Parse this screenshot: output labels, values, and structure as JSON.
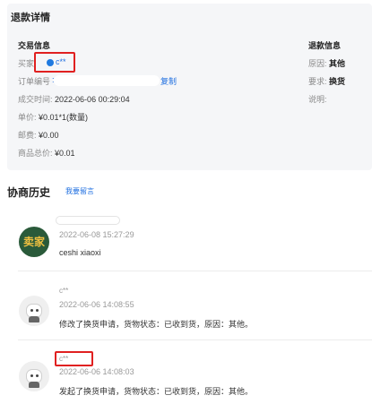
{
  "refund": {
    "title": "退款详情",
    "trade_section": "交易信息",
    "refund_section": "退款信息",
    "buyer_label": "买家",
    "buyer_name": "c**",
    "order_label": "订单编号",
    "order_colon": ":",
    "copy_label": "复制",
    "deal_time_label": "成交时间:",
    "deal_time": "2022-06-06 00:29:04",
    "unit_price_label": "单价:",
    "unit_price": "¥0.01*1(数量)",
    "postage_label": "邮费:",
    "postage": "¥0.00",
    "total_label": "商品总价:",
    "total": "¥0.01",
    "reason_label": "原因:",
    "reason": "其他",
    "request_label": "要求:",
    "request": "换货",
    "note_label": "说明:"
  },
  "history": {
    "title": "协商历史",
    "leave_message": "我要留言",
    "entries": [
      {
        "avatar_text": "卖家",
        "time": "2022-06-08 15:27:29",
        "message": "ceshi xiaoxi"
      },
      {
        "name": "c**",
        "time": "2022-06-06 14:08:55",
        "message": "修改了换货申请，货物状态：已收到货，原因：其他。"
      },
      {
        "name": "c**",
        "time": "2022-06-06 14:08:03",
        "message": "发起了换货申请，货物状态：已收到货，原因：其他。"
      }
    ]
  }
}
